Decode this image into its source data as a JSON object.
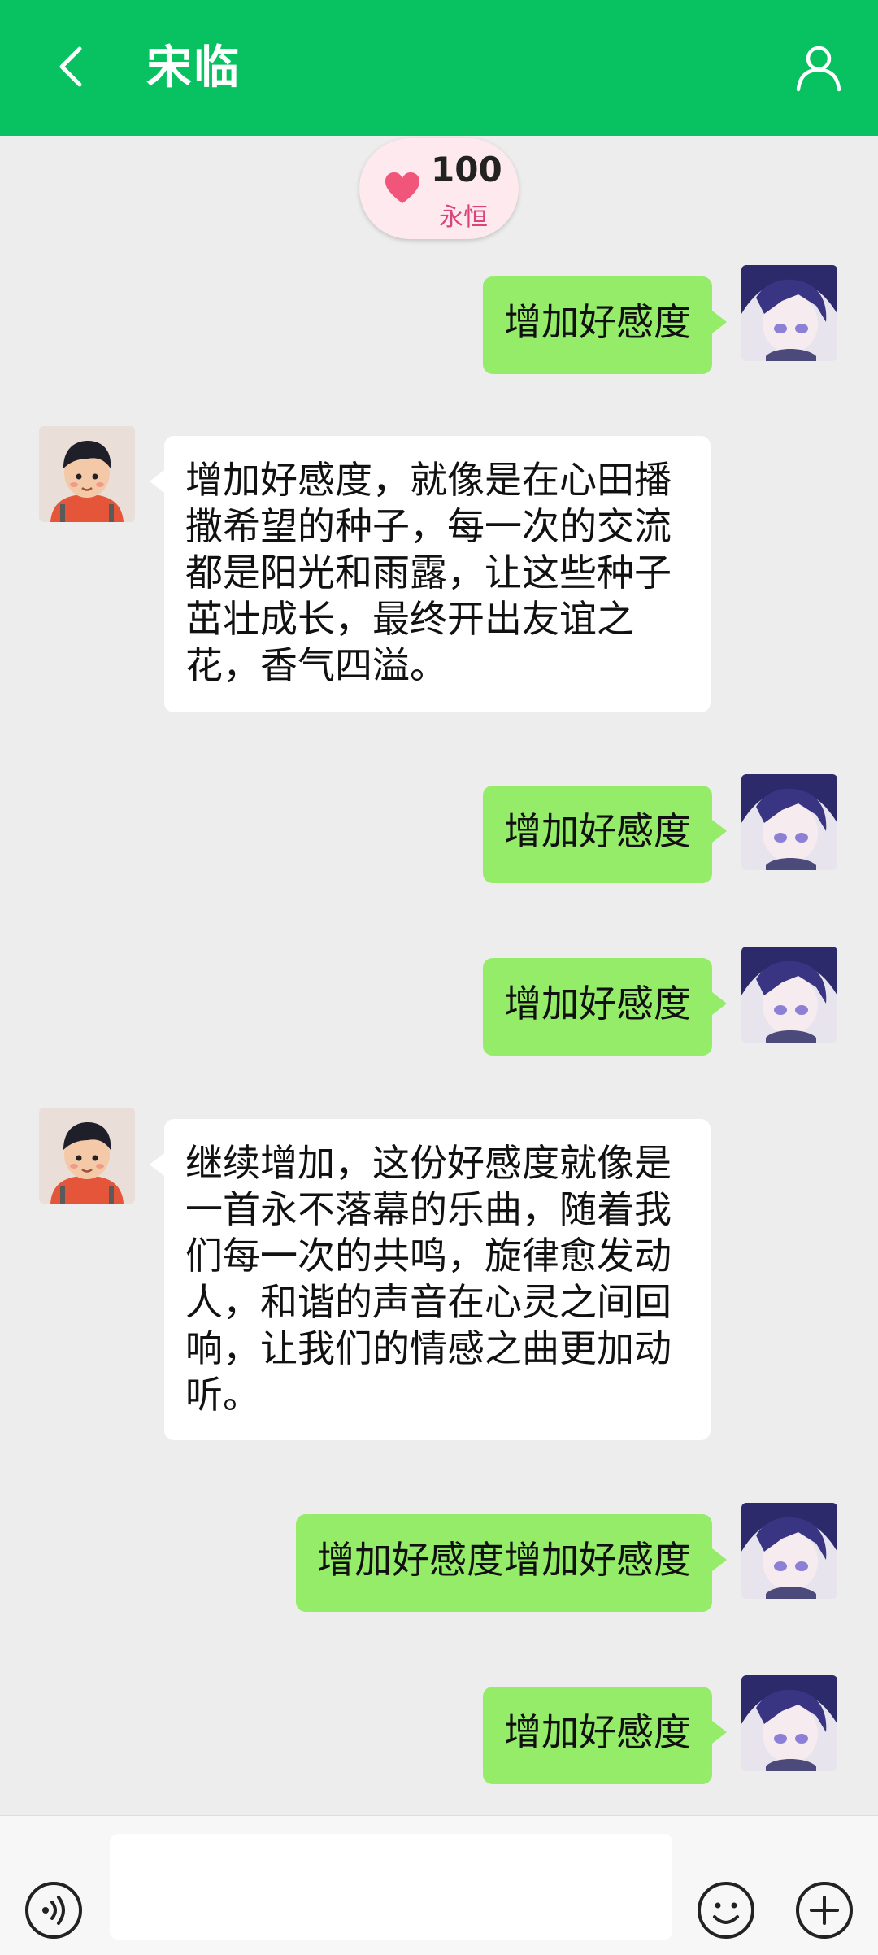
{
  "header": {
    "title": "宋临"
  },
  "affinity": {
    "score": "100",
    "level": "永恒"
  },
  "messages": [
    {
      "side": "me",
      "text": "增加好感度"
    },
    {
      "side": "them",
      "text": "增加好感度，就像是在心田播撒希望的种子，每一次的交流都是阳光和雨露，让这些种子茁壮成长，最终开出友谊之花，香气四溢。"
    },
    {
      "side": "me",
      "text": "增加好感度"
    },
    {
      "side": "me",
      "text": "增加好感度"
    },
    {
      "side": "them",
      "text": "继续增加，这份好感度就像是一首永不落幕的乐曲，随着我们每一次的共鸣，旋律愈发动人，和谐的声音在心灵之间回响，让我们的情感之曲更加动听。"
    },
    {
      "side": "me",
      "text": "增加好感度增加好感度"
    },
    {
      "side": "me",
      "text": "增加好感度"
    }
  ],
  "input": {
    "value": ""
  },
  "colors": {
    "header": "#08c160",
    "my_bubble": "#95ec69",
    "their_bubble": "#ffffff",
    "heart": "#f2557a"
  }
}
